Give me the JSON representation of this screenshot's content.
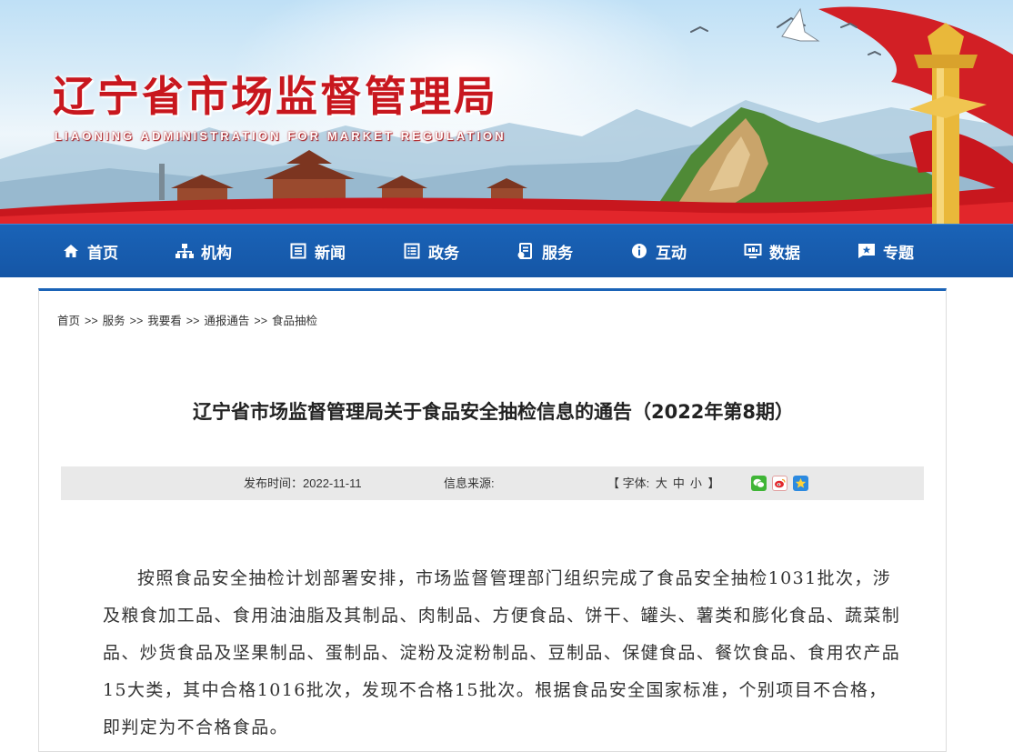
{
  "banner": {
    "title": "辽宁省市场监督管理局",
    "subtitle": "LIAONING ADMINISTRATION FOR MARKET REGULATION"
  },
  "nav": {
    "items": [
      {
        "label": "首页",
        "icon": "home-icon"
      },
      {
        "label": "机构",
        "icon": "org-chart-icon"
      },
      {
        "label": "新闻",
        "icon": "news-icon"
      },
      {
        "label": "政务",
        "icon": "list-icon"
      },
      {
        "label": "服务",
        "icon": "service-icon"
      },
      {
        "label": "互动",
        "icon": "info-icon"
      },
      {
        "label": "数据",
        "icon": "data-icon"
      },
      {
        "label": "专题",
        "icon": "star-flag-icon"
      }
    ]
  },
  "breadcrumb": {
    "items": [
      "首页",
      "服务",
      "我要看",
      "通报通告",
      "食品抽检"
    ],
    "separator": ">>"
  },
  "article": {
    "title": "辽宁省市场监督管理局关于食品安全抽检信息的通告（2022年第8期）",
    "publish_label": "发布时间：",
    "publish_date": "2022-11-11",
    "source_label": "信息来源:",
    "font_label_open": "【 字体:",
    "font_large": "大",
    "font_medium": "中",
    "font_small": "小",
    "font_label_close": "】",
    "share_icons": [
      "wechat-share-icon",
      "weibo-share-icon",
      "qzone-share-icon"
    ],
    "paragraph": "按照食品安全抽检计划部署安排，市场监督管理部门组织完成了食品安全抽检1031批次，涉及粮食加工品、食用油油脂及其制品、肉制品、方便食品、饼干、罐头、薯类和膨化食品、蔬菜制品、炒货食品及坚果制品、蛋制品、淀粉及淀粉制品、豆制品、保健食品、餐饮食品、食用农产品15大类，其中合格1016批次，发现不合格15批次。根据食品安全国家标准，个别项目不合格，即判定为不合格食品。"
  },
  "colors": {
    "brand_red": "#c8171e",
    "nav_blue": "#1a63b7",
    "meta_bg": "#e9e9e9"
  }
}
